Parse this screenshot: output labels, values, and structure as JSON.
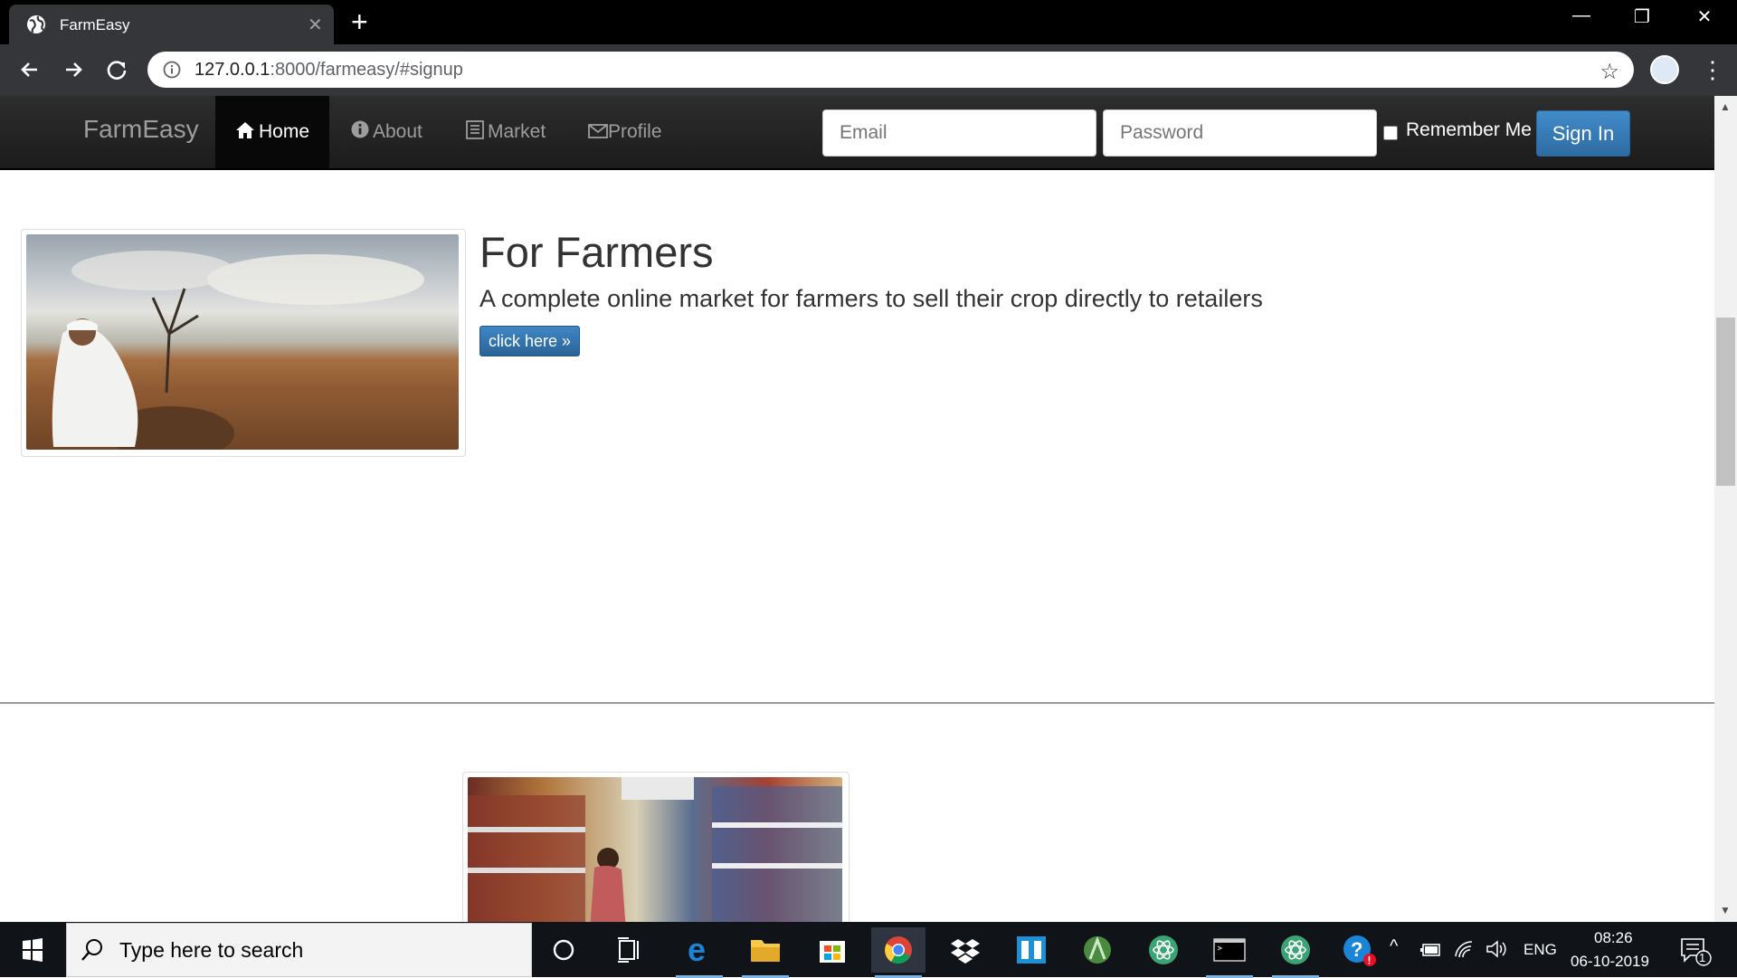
{
  "browser": {
    "tab_title": "FarmEasy",
    "url_host": "127.0.0.1",
    "url_rest": ":8000/farmeasy/#signup"
  },
  "site": {
    "brand": "FarmEasy",
    "nav": [
      {
        "label": "Home",
        "icon": "home-icon",
        "active": true
      },
      {
        "label": "About",
        "icon": "info-icon"
      },
      {
        "label": "Market",
        "icon": "list-icon"
      },
      {
        "label": "Profile",
        "icon": "envelope-icon"
      }
    ],
    "login": {
      "email_placeholder": "Email",
      "password_placeholder": "Password",
      "remember_label": "Remember Me",
      "signin_label": "Sign In"
    },
    "farmers": {
      "title": "For Farmers",
      "description": "A complete online market for farmers to sell their crop directly to retailers",
      "button": "click here »"
    }
  },
  "taskbar": {
    "search_placeholder": "Type here to search",
    "language": "ENG",
    "time": "08:26",
    "date": "06-10-2019",
    "notifications": "1"
  },
  "colors": {
    "navbar": "#222222",
    "primary": "#337ab7",
    "taskbar": "#101419"
  }
}
